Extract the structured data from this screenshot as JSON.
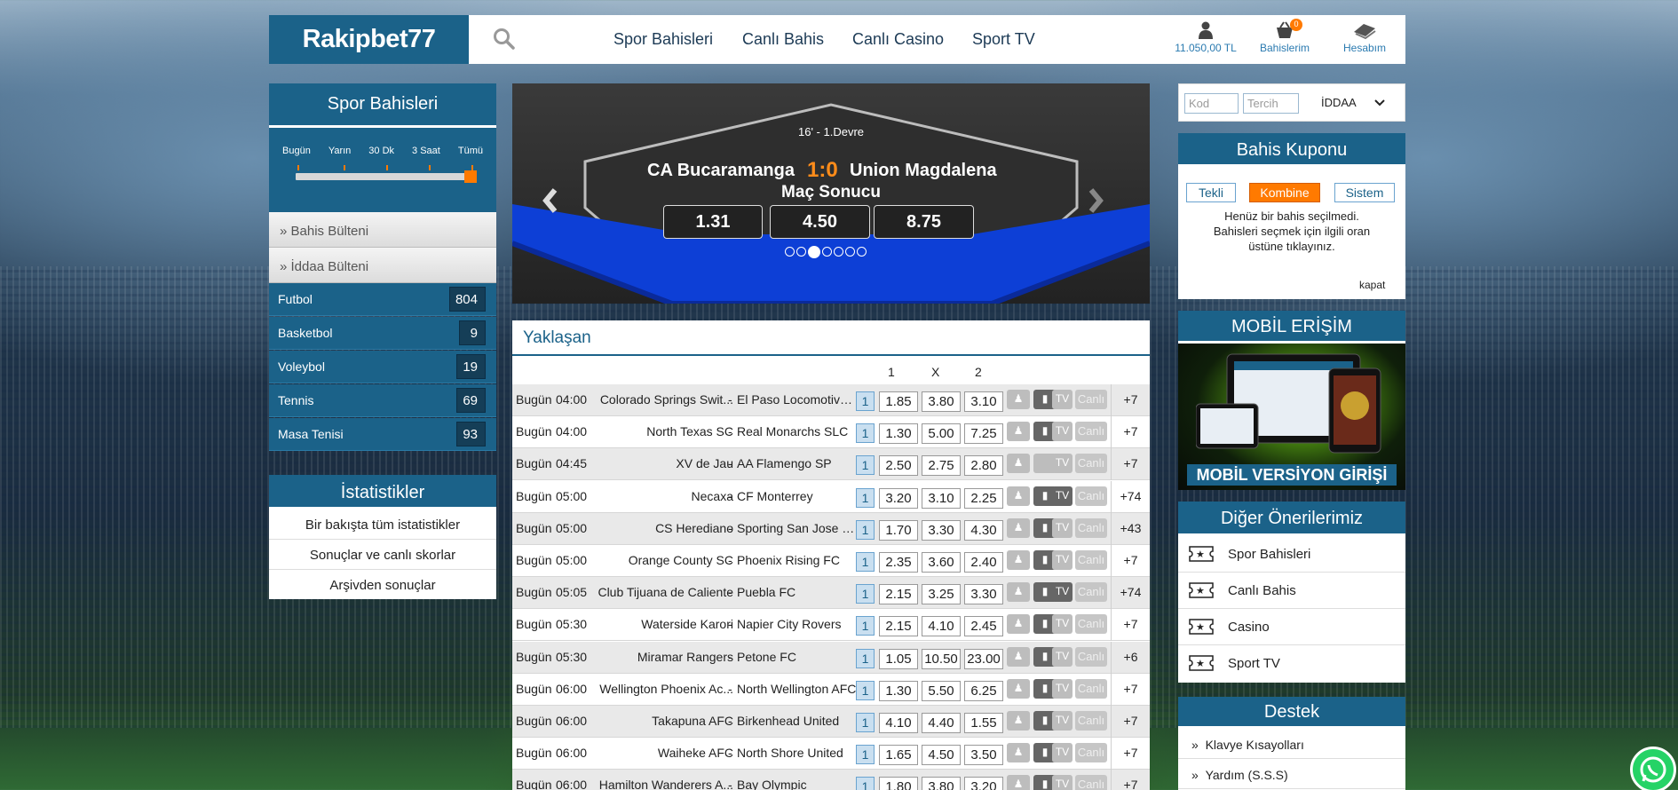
{
  "header": {
    "logo": "Rakipbet77",
    "nav": [
      "Spor Bahisleri",
      "Canlı Bahis",
      "Canlı Casino",
      "Sport TV"
    ],
    "balance": "11.050,00 TL",
    "bets_label": "Bahislerim",
    "bets_badge": "0",
    "account_label": "Hesabım"
  },
  "left": {
    "title": "Spor Bahisleri",
    "range": [
      "Bugün",
      "Yarın",
      "30 Dk",
      "3 Saat",
      "Tümü"
    ],
    "bulletins": [
      "Bahis Bülteni",
      "İddaa Bülteni"
    ],
    "sports": [
      {
        "name": "Futbol",
        "count": "804"
      },
      {
        "name": "Basketbol",
        "count": "9"
      },
      {
        "name": "Voleybol",
        "count": "19"
      },
      {
        "name": "Tennis",
        "count": "69"
      },
      {
        "name": "Masa Tenisi",
        "count": "93"
      }
    ],
    "stats_title": "İstatistikler",
    "stats_links": [
      "Bir bakışta tüm istatistikler",
      "Sonuçlar ve canlı skorlar",
      "Arşivden sonuçlar"
    ]
  },
  "banner": {
    "minute": "16' - 1.Devre",
    "home": "CA Bucaramanga",
    "score": "1:0",
    "away": "Union Magdalena",
    "market": "Maç Sonucu",
    "odds": [
      "1.31",
      "4.50",
      "8.75"
    ],
    "dots": 7,
    "active_dot": 3
  },
  "matches": {
    "title": "Yaklaşan",
    "headers": [
      "1",
      "X",
      "2"
    ],
    "rows": [
      {
        "day": "Bugün",
        "time": "04:00",
        "home": "Colorado Springs Swit...",
        "away": "El Paso Locomotive ...",
        "mb": "1",
        "odds": [
          "1.85",
          "3.80",
          "3.10"
        ],
        "stats": true,
        "tv": false,
        "plus": "+7"
      },
      {
        "day": "Bugün",
        "time": "04:00",
        "home": "North Texas SC",
        "away": "Real Monarchs SLC",
        "mb": "1",
        "odds": [
          "1.30",
          "5.00",
          "7.25"
        ],
        "stats": true,
        "tv": false,
        "plus": "+7"
      },
      {
        "day": "Bugün",
        "time": "04:45",
        "home": "XV de Jau",
        "away": "AA Flamengo SP",
        "mb": "1",
        "odds": [
          "2.50",
          "2.75",
          "2.80"
        ],
        "stats": false,
        "tv": false,
        "plus": "+7"
      },
      {
        "day": "Bugün",
        "time": "05:00",
        "home": "Necaxa",
        "away": "CF Monterrey",
        "mb": "1",
        "odds": [
          "3.20",
          "3.10",
          "2.25"
        ],
        "stats": true,
        "tv": true,
        "plus": "+74"
      },
      {
        "day": "Bugün",
        "time": "05:00",
        "home": "CS Herediano",
        "away": "Sporting San Jose FC",
        "mb": "1",
        "odds": [
          "1.70",
          "3.30",
          "4.30"
        ],
        "stats": true,
        "tv": false,
        "plus": "+43"
      },
      {
        "day": "Bugün",
        "time": "05:00",
        "home": "Orange County SC",
        "away": "Phoenix Rising FC",
        "mb": "1",
        "odds": [
          "2.35",
          "3.60",
          "2.40"
        ],
        "stats": true,
        "tv": false,
        "plus": "+7"
      },
      {
        "day": "Bugün",
        "time": "05:05",
        "home": "Club Tijuana de Caliente",
        "away": "Puebla FC",
        "mb": "1",
        "odds": [
          "2.15",
          "3.25",
          "3.30"
        ],
        "stats": true,
        "tv": true,
        "plus": "+74"
      },
      {
        "day": "Bugün",
        "time": "05:30",
        "home": "Waterside Karori",
        "away": "Napier City Rovers",
        "mb": "1",
        "odds": [
          "2.15",
          "4.10",
          "2.45"
        ],
        "stats": true,
        "tv": false,
        "plus": "+7"
      },
      {
        "day": "Bugün",
        "time": "05:30",
        "home": "Miramar Rangers",
        "away": "Petone FC",
        "mb": "1",
        "odds": [
          "1.05",
          "10.50",
          "23.00"
        ],
        "stats": true,
        "tv": false,
        "plus": "+6"
      },
      {
        "day": "Bugün",
        "time": "06:00",
        "home": "Wellington Phoenix Ac...",
        "away": "North Wellington AFC",
        "mb": "1",
        "odds": [
          "1.30",
          "5.50",
          "6.25"
        ],
        "stats": true,
        "tv": false,
        "plus": "+7"
      },
      {
        "day": "Bugün",
        "time": "06:00",
        "home": "Takapuna AFC",
        "away": "Birkenhead United",
        "mb": "1",
        "odds": [
          "4.10",
          "4.40",
          "1.55"
        ],
        "stats": true,
        "tv": false,
        "plus": "+7"
      },
      {
        "day": "Bugün",
        "time": "06:00",
        "home": "Waiheke AFC",
        "away": "North Shore United",
        "mb": "1",
        "odds": [
          "1.65",
          "4.50",
          "3.50"
        ],
        "stats": true,
        "tv": false,
        "plus": "+7"
      },
      {
        "day": "Bugün",
        "time": "06:00",
        "home": "Hamilton Wanderers A...",
        "away": "Bay Olympic",
        "mb": "1",
        "odds": [
          "1.80",
          "3.80",
          "3.20"
        ],
        "stats": true,
        "tv": false,
        "plus": "+7"
      }
    ]
  },
  "right": {
    "kod_placeholder": "Kod",
    "tercih_placeholder": "Tercih",
    "select": "İDDAA",
    "kupon_title": "Bahis Kuponu",
    "kupon_tabs": [
      "Tekli",
      "Kombine",
      "Sistem"
    ],
    "kupon_msg1": "Henüz bir bahis seçilmedi.",
    "kupon_msg2": "Bahisleri seçmek için ilgili oran",
    "kupon_msg3": "üstüne tıklayınız.",
    "kupon_close": "kapat",
    "mobil_title": "MOBİL ERİŞİM",
    "mobil_banner": "MOBİL VERSİYON GİRİŞİ",
    "oneri_title": "Diğer Önerilerimiz",
    "oneri": [
      "Spor Bahisleri",
      "Canlı Bahis",
      "Casino",
      "Sport TV"
    ],
    "destek_title": "Destek",
    "destek": [
      "Klavye Kısayolları",
      "Yardım (S.S.S)"
    ]
  },
  "colors": {
    "primary": "#1b6289",
    "accent": "#ff7a00",
    "whatsapp": "#25d366"
  }
}
